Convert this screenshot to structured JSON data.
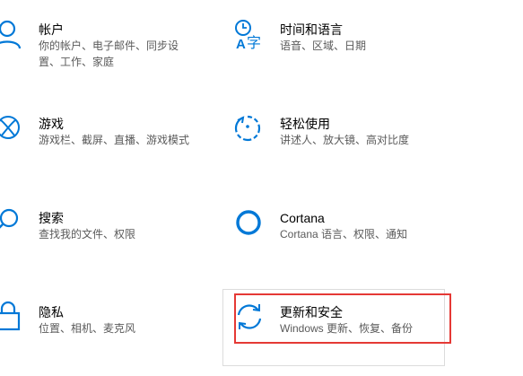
{
  "accent_color": "#0078d7",
  "highlight_color": "#e53935",
  "tiles": [
    {
      "id": "accounts",
      "icon": "person-icon",
      "title": "帐户",
      "desc_line1": "你的帐户、电子邮件、同步设",
      "desc_line2": "置、工作、家庭"
    },
    {
      "id": "time-language",
      "icon": "time-language-icon",
      "title": "时间和语言",
      "desc_line1": "语音、区域、日期",
      "desc_line2": ""
    },
    {
      "id": "gaming",
      "icon": "xbox-icon",
      "title": "游戏",
      "desc_line1": "游戏栏、截屏、直播、游戏模式",
      "desc_line2": ""
    },
    {
      "id": "ease-of-access",
      "icon": "ease-of-access-icon",
      "title": "轻松使用",
      "desc_line1": "讲述人、放大镜、高对比度",
      "desc_line2": ""
    },
    {
      "id": "search",
      "icon": "search-icon",
      "title": "搜索",
      "desc_line1": "查找我的文件、权限",
      "desc_line2": ""
    },
    {
      "id": "cortana",
      "icon": "cortana-icon",
      "title": "Cortana",
      "desc_line1": "Cortana 语言、权限、通知",
      "desc_line2": ""
    },
    {
      "id": "privacy",
      "icon": "lock-icon",
      "title": "隐私",
      "desc_line1": "位置、相机、麦克风",
      "desc_line2": ""
    },
    {
      "id": "update-security",
      "icon": "sync-icon",
      "title": "更新和安全",
      "desc_line1": "Windows 更新、恢复、备份",
      "desc_line2": ""
    }
  ]
}
